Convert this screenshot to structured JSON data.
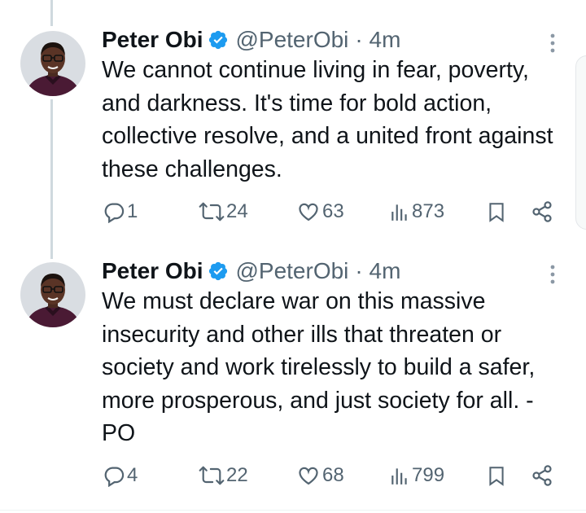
{
  "tweets": [
    {
      "author_name": "Peter Obi",
      "handle": "@PeterObi",
      "time": "· 4m",
      "text": "We cannot continue living in fear, poverty, and darkness. It's time for bold action, collective resolve, and a united front against these challenges.",
      "replies": "1",
      "retweets": "24",
      "likes": "63",
      "views": "873"
    },
    {
      "author_name": "Peter Obi",
      "handle": "@PeterObi",
      "time": "· 4m",
      "text": "We must declare war on this massive insecurity and other ills that threaten or society and work tirelessly to build a safer, more prosperous, and just society for all. -PO",
      "replies": "4",
      "retweets": "22",
      "likes": "68",
      "views": "799"
    }
  ],
  "colors": {
    "text": "#0f1419",
    "secondary": "#536471",
    "verified_blue": "#1d9bf0",
    "thread_line": "#cfd9de"
  },
  "icons": [
    "verified-badge-icon",
    "more-options-icon",
    "reply-icon",
    "retweet-icon",
    "like-icon",
    "views-icon",
    "bookmark-icon",
    "share-icon"
  ]
}
